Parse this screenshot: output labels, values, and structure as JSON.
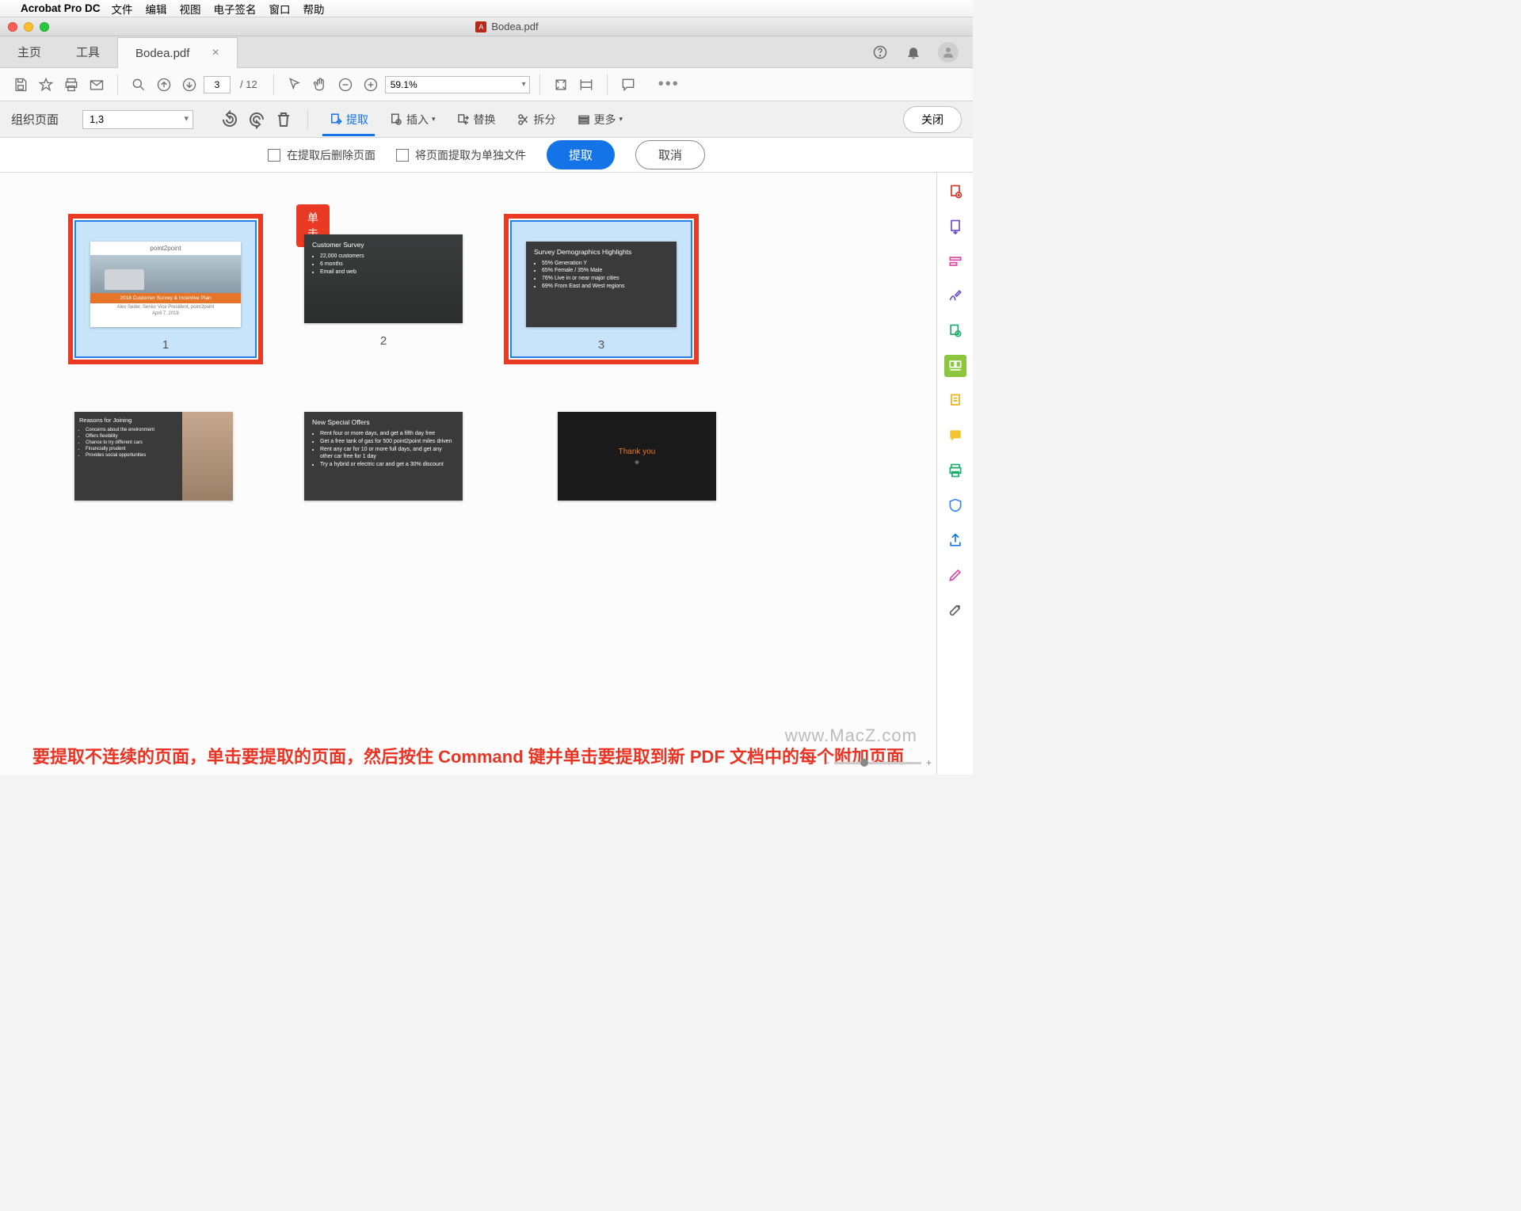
{
  "menubar": {
    "app": "Acrobat Pro DC",
    "items": [
      "文件",
      "编辑",
      "视图",
      "电子签名",
      "窗口",
      "帮助"
    ]
  },
  "window": {
    "title": "Bodea.pdf"
  },
  "tabs": {
    "home": "主页",
    "tools": "工具",
    "document": "Bodea.pdf"
  },
  "toolbar": {
    "page_current": "3",
    "page_total": "/ 12",
    "zoom": "59.1%"
  },
  "organize": {
    "label": "组织页面",
    "range": "1,3",
    "extract": "提取",
    "insert": "插入",
    "replace": "替换",
    "split": "拆分",
    "more": "更多",
    "close": "关闭"
  },
  "extract_opts": {
    "delete_after": "在提取后删除页面",
    "separate_files": "将页面提取为单独文件",
    "extract_btn": "提取",
    "cancel_btn": "取消"
  },
  "callout": "单击",
  "thumbs": {
    "nums": [
      "1",
      "2",
      "3"
    ],
    "slide1": {
      "brand": "point2point",
      "banner": "2018 Customer Survey & Incentive Plan",
      "author": "Alex Seder, Senior Vice President, point2point",
      "date": "April 7, 2018"
    },
    "slide2": {
      "title": "Customer Survey",
      "items": [
        "22,000 customers",
        "6 months",
        "Email and web"
      ]
    },
    "slide3": {
      "title": "Survey Demographics Highlights",
      "items": [
        "55% Generation Y",
        "65% Female / 35% Male",
        "76% Live in or near major cities",
        "69% From East and West regions"
      ]
    },
    "slide4": {
      "title": "Reasons for Joining",
      "items": [
        "Concerns about the environment",
        "Offers flexibility",
        "Chance to try different cars",
        "Financially prudent",
        "Provides social opportunities"
      ]
    },
    "slide5": {
      "title": "New Special Offers",
      "items": [
        "Rent four or more days, and get a fifth day free",
        "Get a free tank of gas for 500 point2point miles driven",
        "Rent any car for 10 or more full days, and get any other car free for 1 day",
        "Try a hybrid or electric car and get a 30% discount"
      ]
    },
    "slide6": {
      "text": "Thank you"
    }
  },
  "instruction": "要提取不连续的页面，单击要提取的页面，然后按住 Command 键并单击要提取到新 PDF 文档中的每个附加页面",
  "watermark": "www.MacZ.com"
}
